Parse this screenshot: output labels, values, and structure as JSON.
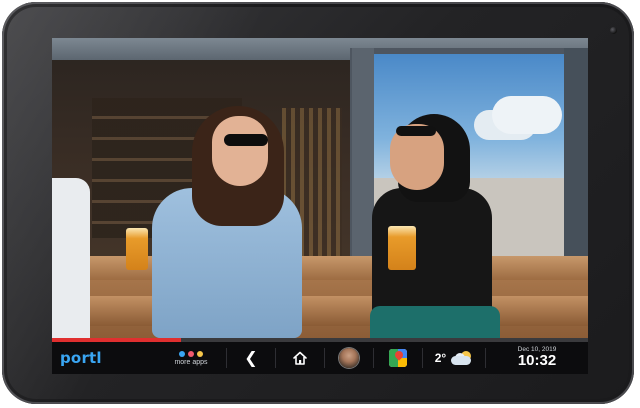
{
  "taskbar": {
    "brand": "portl",
    "more_apps": {
      "label": "more apps",
      "dot_colors": [
        "#3aa6f3",
        "#f05a6e",
        "#f6c64a"
      ]
    },
    "back_icon": "chevron-left-icon",
    "home_icon": "home-icon",
    "profile_icon": "avatar",
    "maps_icon": "maps-icon",
    "weather": {
      "temperature": "2°",
      "icon": "partly-cloudy-icon"
    },
    "date": "Dec 10, 2019",
    "time": "10:32",
    "progress_fraction": 0.24
  },
  "colors": {
    "brand": "#3aa6f3",
    "progress": "#e02f2f",
    "taskbar_bg": "#0c0c0e"
  }
}
